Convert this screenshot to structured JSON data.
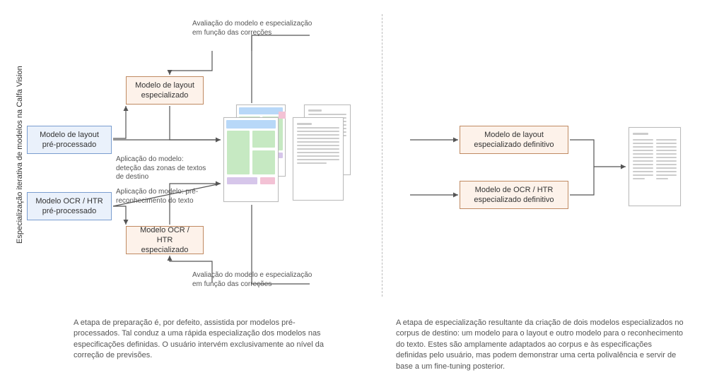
{
  "title_vertical": "Especialização iterativa de modelos na Calfa Vision",
  "left": {
    "top_caption": "Avaliação do modelo e especialização em função das correções",
    "box_layout_pre": "Modelo de layout pré-processado",
    "box_layout_special": "Modelo de layout especializado",
    "caption_layout_apply": "Aplicação do modelo: deteção das zonas de textos de destino",
    "box_ocr_pre": "Modelo OCR / HTR pré-processado",
    "caption_ocr_apply": "Aplicação do modelo: pré-reconhecimento do texto",
    "box_ocr_special": "Modelo OCR / HTR especializado",
    "bottom_caption": "Avaliação do modelo e especialização em função das correções",
    "paragraph": "A etapa de preparação é, por defeito,  assistida por modelos pré-processados. Tal conduz a uma rápida especialização dos modelos nas especificações definidas. O usuário intervém exclusivamente ao nível da correção de previsões."
  },
  "right": {
    "box_layout_def": "Modelo de layout especializado definitivo",
    "box_ocr_def": "Modelo de OCR / HTR especializado definitivo",
    "paragraph": "A etapa de especialização resultante da criação de dois modelos especializados no corpus de destino: um modelo para o layout e outro modelo para o reconhecimento do texto. Estes são amplamente adaptados ao corpus e às especificações definidas pelo usuário, mas podem demonstrar uma certa polivalência e servir de base a um fine-tuning posterior."
  }
}
